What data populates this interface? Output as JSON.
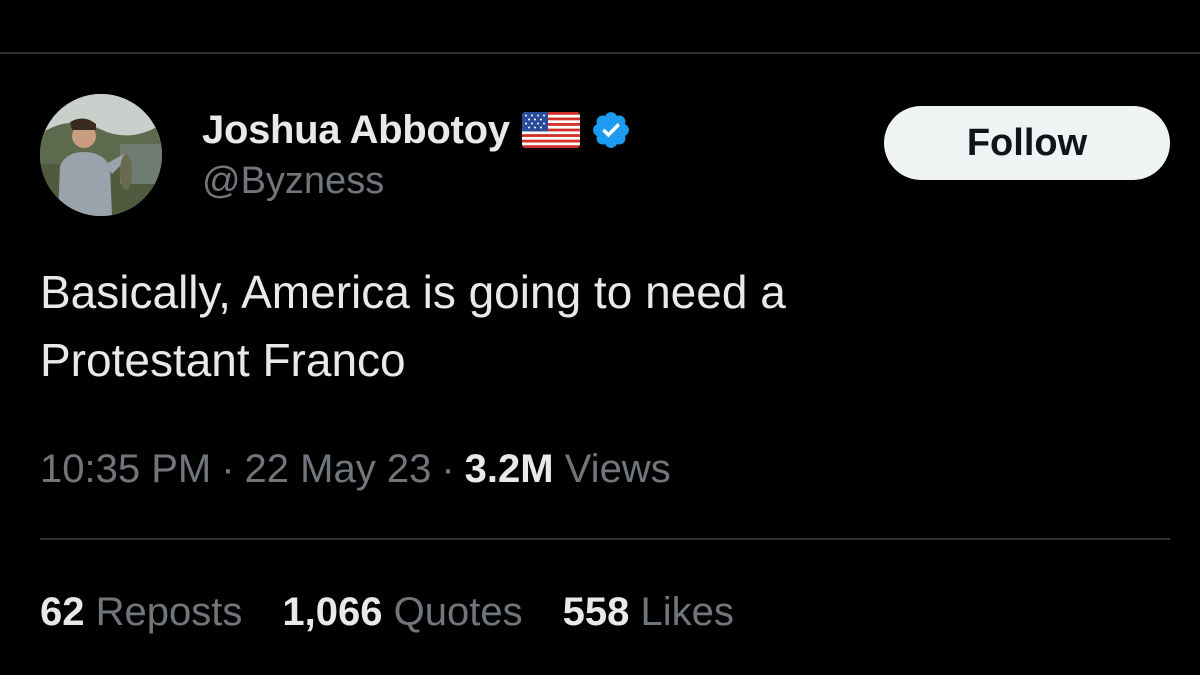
{
  "author": {
    "display_name": "Joshua Abbotoy",
    "handle": "@Byzness",
    "flag_icon": "us-flag-icon",
    "verified_icon": "verified-badge-icon",
    "verified_color": "#1d9bf0"
  },
  "follow_button": {
    "label": "Follow"
  },
  "tweet": {
    "text": "Basically, America is going to need a\nProtestant Franco"
  },
  "meta": {
    "time": "10:35 PM",
    "separator": "·",
    "date": "22 May 23",
    "views_count": "3.2M",
    "views_label": "Views"
  },
  "stats": {
    "reposts_count": "62",
    "reposts_label": "Reposts",
    "quotes_count": "1,066",
    "quotes_label": "Quotes",
    "likes_count": "558",
    "likes_label": "Likes"
  },
  "colors": {
    "background": "#000000",
    "primary_text": "#e7e9ea",
    "secondary_text": "#71767b",
    "divider": "#2f3336",
    "follow_bg": "#eff3f4"
  }
}
